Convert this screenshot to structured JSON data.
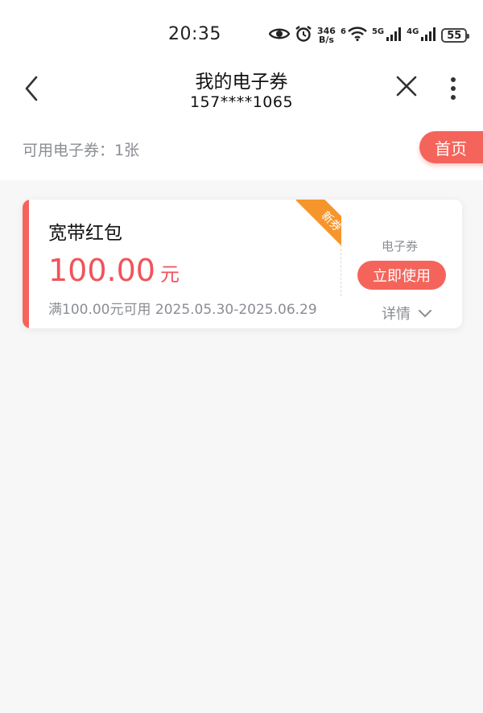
{
  "status_bar": {
    "time": "20:35",
    "speed_value": "346",
    "speed_unit": "B/s",
    "wifi_label": "6",
    "net1_label": "5G",
    "net2_label": "4G",
    "battery": "55"
  },
  "nav": {
    "title": "我的电子券",
    "subtitle": "157****1065"
  },
  "summary": {
    "count_text": "可用电子券：1张",
    "home_label": "首页"
  },
  "coupons": [
    {
      "name": "宽带红包",
      "amount": "100.00",
      "unit": "元",
      "condition": "满100.00元可用 2025.05.30-2025.06.29",
      "badge": "新券",
      "type": "电子券",
      "use_label": "立即使用",
      "detail_label": "详情"
    }
  ],
  "colors": {
    "accent": "#f5645b",
    "amount": "#f0545a",
    "badge": "#f6952b",
    "muted": "#8a8d93"
  },
  "icons": {
    "back": "chevron-left-icon",
    "close": "close-icon",
    "more": "more-vertical-icon",
    "detail": "chevron-down-icon"
  }
}
